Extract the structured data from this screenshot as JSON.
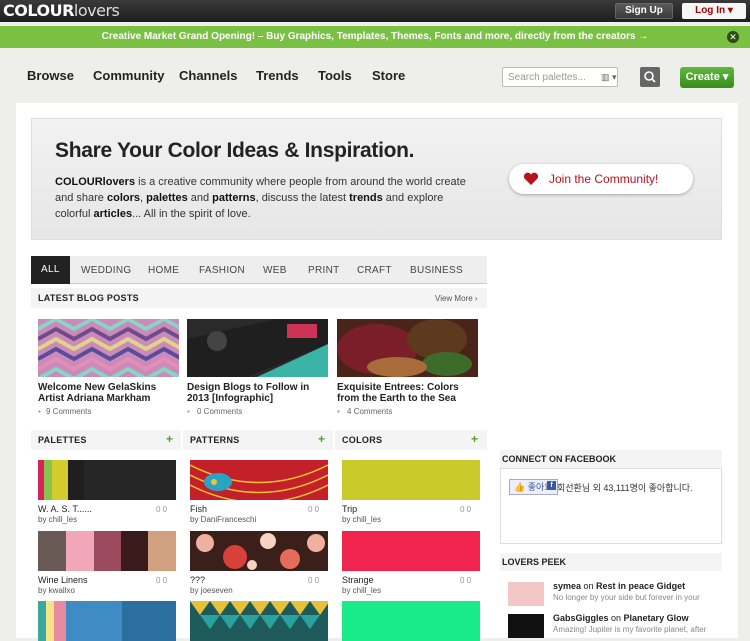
{
  "topbar": {
    "logo_bold": "COLOUR",
    "logo_light": "lovers",
    "signup_label": "Sign Up",
    "login_label": "Log In"
  },
  "promo": {
    "text": "Creative Market Grand Opening! – Buy Graphics, Templates, Themes, Fonts and more, directly from the creators →",
    "close": "✕"
  },
  "nav": {
    "items": [
      "Browse",
      "Community",
      "Channels",
      "Trends",
      "Tools",
      "Store"
    ],
    "search_placeholder": "Search palettes...",
    "search_grid_icon": "grid-icon",
    "create_label": "Create ▾"
  },
  "hero": {
    "title": "Share Your Color Ideas & Inspiration.",
    "join_label": "Join the Community!",
    "t1": "COLOURlovers",
    "t2": " is a creative community where people from around the world create and share ",
    "t3": "colors",
    "t4": ", ",
    "t5": "palettes",
    "t6": " and ",
    "t7": "patterns",
    "t8": ", discuss the latest ",
    "t9": "trends",
    "t10": " and explore colorful ",
    "t11": "articles",
    "t12": "... All in the spirit of love."
  },
  "tabs": [
    "ALL",
    "WEDDING",
    "HOME",
    "FASHION",
    "WEB",
    "PRINT",
    "CRAFT",
    "BUSINESS"
  ],
  "blog": {
    "heading": "LATEST BLOG POSTS",
    "view_more": "View More ›",
    "posts": [
      {
        "title": "Welcome New GelaSkins Artist Adriana Markham",
        "comments": "9 Comments"
      },
      {
        "title": "Design Blogs to Follow in 2013 [Infographic]",
        "comments": "0 Comments"
      },
      {
        "title": "Exquisite Entrees: Colors from the Earth to the Sea",
        "comments": "4 Comments"
      }
    ]
  },
  "columns": {
    "palettes": {
      "heading": "PALETTES",
      "items": [
        {
          "name": "W. A. S. T......",
          "by": "by chill_les",
          "stats": "0  0"
        },
        {
          "name": "Wine Linens",
          "by": "by kwallxo",
          "stats": "0  0"
        }
      ]
    },
    "patterns": {
      "heading": "PATTERNS",
      "items": [
        {
          "name": "Fish",
          "by": "by DaniFranceschi",
          "stats": "0  0"
        },
        {
          "name": "???",
          "by": "by joeseven",
          "stats": "0  0"
        }
      ]
    },
    "colors": {
      "heading": "COLORS",
      "items": [
        {
          "name": "Trip",
          "by": "by chill_les",
          "stats": "0  0"
        },
        {
          "name": "Strange",
          "by": "by chill_les",
          "stats": "0  0"
        }
      ]
    }
  },
  "facebook": {
    "heading": "CONNECT ON FACEBOOK",
    "like": "👍 좋아요",
    "text": "회선환님 외 43,111명이 좋아합니다."
  },
  "peek": {
    "heading": "LOVERS PEEK",
    "items": [
      {
        "user": "symea",
        "on": " on ",
        "post": "Rest in peace Gidget",
        "sub": "No longer by your side but forever in your"
      },
      {
        "user": "GabsGiggles",
        "on": " on ",
        "post": "Planetary Glow",
        "sub": "Amazing! Jupiter is my favorite planet, after"
      }
    ]
  },
  "colors": {
    "accent_green": "#7ac143",
    "brand_red": "#b8121a",
    "dark": "#222222"
  }
}
